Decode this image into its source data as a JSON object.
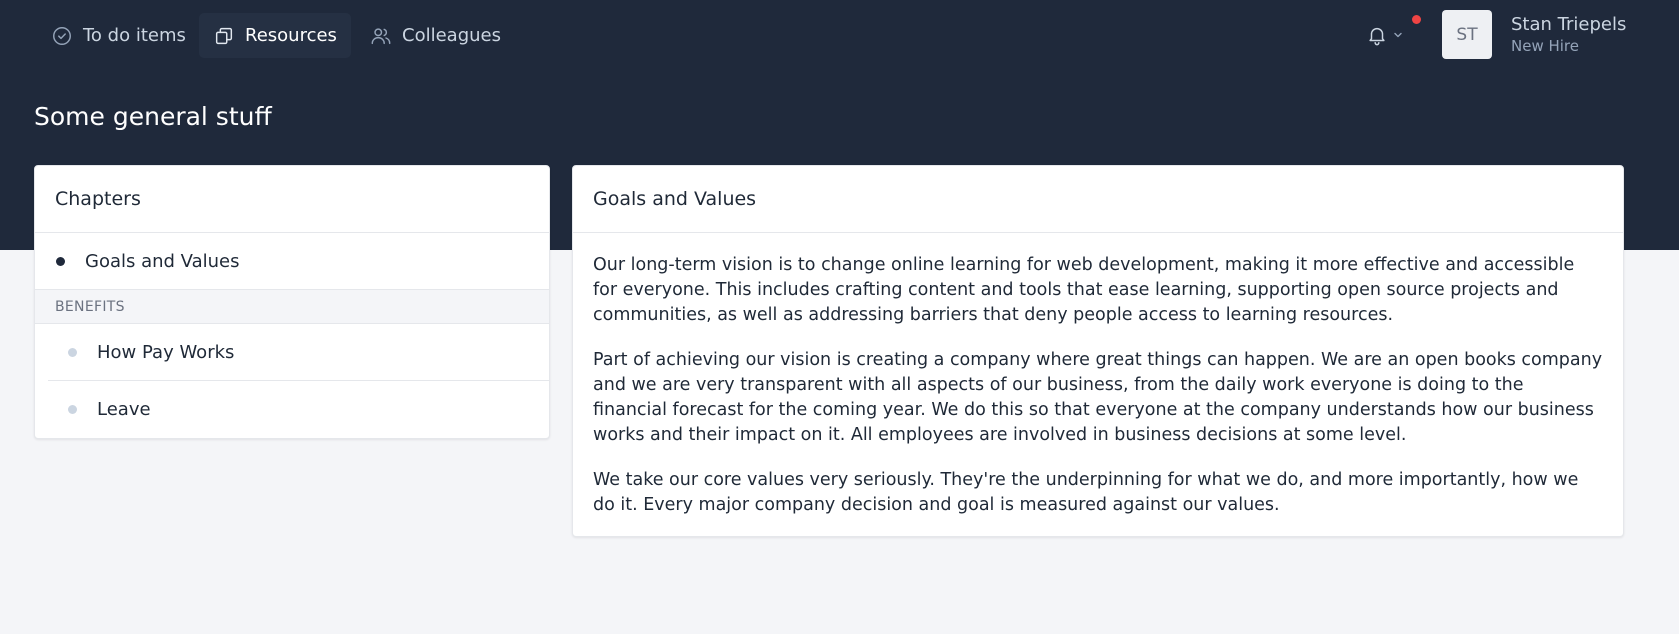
{
  "nav": {
    "items": [
      {
        "label": "To do items",
        "icon": "check-circle-icon",
        "active": false
      },
      {
        "label": "Resources",
        "icon": "documents-icon",
        "active": true
      },
      {
        "label": "Colleagues",
        "icon": "users-icon",
        "active": false
      }
    ]
  },
  "user": {
    "initials": "ST",
    "name": "Stan Triepels",
    "role": "New Hire"
  },
  "page": {
    "title": "Some general stuff"
  },
  "chapters": {
    "header": "Chapters",
    "items": [
      {
        "label": "Goals and Values",
        "active": true
      },
      {
        "label": "How Pay Works",
        "active": false
      },
      {
        "label": "Leave",
        "active": false
      }
    ],
    "section_label": "BENEFITS"
  },
  "content": {
    "title": "Goals and Values",
    "paragraphs": [
      "Our long-term vision is to change online learning for web development, making it more effective and accessible for everyone. This includes crafting content and tools that ease learning, supporting open source projects and communities, as well as addressing barriers that deny people access to learning resources.",
      "Part of achieving our vision is creating a company where great things can happen. We are an open books company and we are very transparent with all aspects of our business, from the daily work everyone is doing to the financial forecast for the coming year. We do this so that everyone at the company understands how our business works and their impact on it. All employees are involved in business decisions at some level.",
      "We take our core values very seriously. They're the underpinning for what we do, and more importantly, how we do it. Every major company decision and goal is measured against our values."
    ]
  },
  "colors": {
    "header_bg": "#1f293b",
    "page_bg": "#f4f5f8",
    "notification_dot": "#ef4444"
  }
}
